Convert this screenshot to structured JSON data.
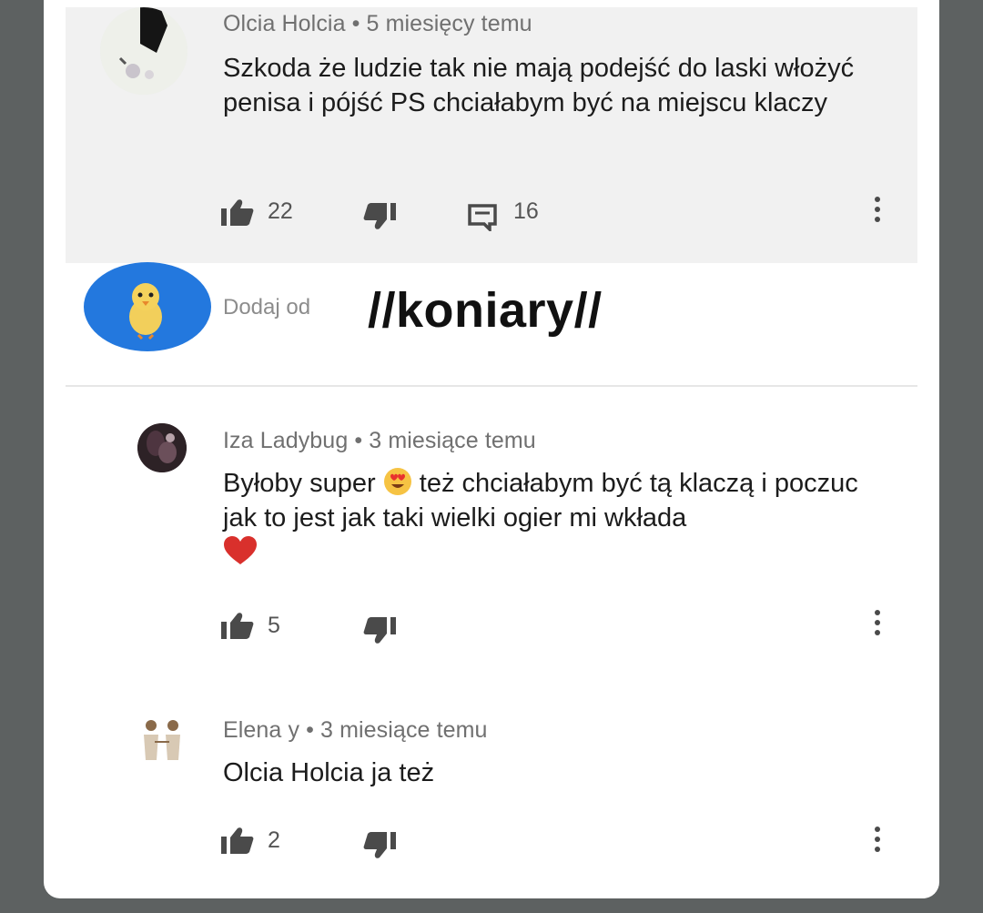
{
  "comments": [
    {
      "author": "Olcia Holcia",
      "sep": "•",
      "time": "5 miesięcy temu",
      "text": "Szkoda że ludzie tak nie mają podejść do laski włożyć penisa i pójść PS chciałabym być na miejscu klaczy",
      "likes": "22",
      "replies": "16"
    },
    {
      "author": "Iza Ladybug",
      "sep": "•",
      "time": "3 miesiące temu",
      "text_before_emoji": "Byłoby super",
      "text_after_emoji": "też chciałabym być tą klaczą i poczuc jak to jest jak taki wielki ogier mi wkłada",
      "likes": "5"
    },
    {
      "author": "Elena y",
      "sep": "•",
      "time": "3 miesiące temu",
      "text": "Olcia Holcia ja też",
      "likes": "2"
    }
  ],
  "add_comment": {
    "placeholder": "Dodaj od"
  },
  "watermark": "//koniary//",
  "icons": {
    "like": "thumbs-up-icon",
    "dislike": "thumbs-down-icon",
    "reply": "comment-icon",
    "more": "more-vertical-icon"
  },
  "colors": {
    "background": "#5d6161",
    "card": "#ffffff",
    "highlight": "#f1f1f1",
    "avatar_blue": "#2378de"
  }
}
